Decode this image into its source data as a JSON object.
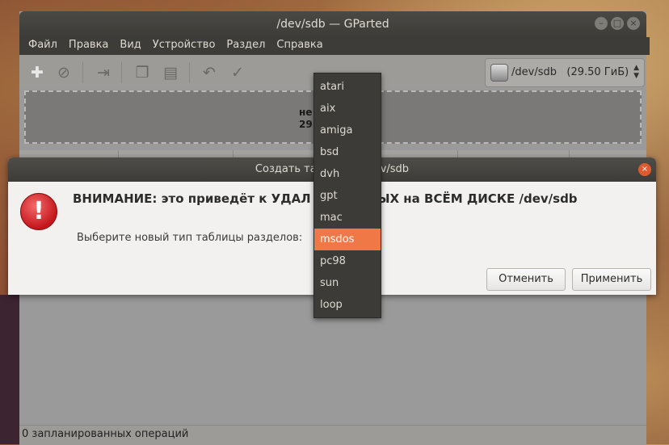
{
  "window": {
    "title": "/dev/sdb — GParted",
    "menu": [
      "Файл",
      "Правка",
      "Вид",
      "Устройство",
      "Раздел",
      "Справка"
    ],
    "device": "/dev/sdb",
    "device_size": "(29.50 ГиБ)",
    "disk_label1": "не р",
    "disk_label2": "29.5",
    "status": "0 запланированных операций"
  },
  "dialog": {
    "title": "Создать таблиц          на /dev/sdb",
    "warning": "ВНИМАНИЕ: это приведёт к УДАЛ           ЕХ ДАННЫХ на ВСЁМ ДИСКЕ /dev/sdb",
    "label": "Выберите новый тип таблицы разделов:",
    "cancel_label": "Отменить",
    "apply_label": "Применить",
    "options": [
      "atari",
      "aix",
      "amiga",
      "bsd",
      "dvh",
      "gpt",
      "mac",
      "msdos",
      "pc98",
      "sun",
      "loop"
    ],
    "selected": "msdos"
  },
  "colors": {
    "accent": "#f07746",
    "titlebar": "#3d3c38",
    "dialog_bg": "#f2f1f0",
    "warning_red": "#c4161c"
  },
  "icons": {
    "new_table": "new-partition-icon",
    "delete": "delete-icon",
    "resize": "resize-move-icon",
    "copy": "copy-icon",
    "paste": "paste-icon",
    "undo": "undo-icon",
    "apply": "apply-check-icon",
    "warning": "error-icon"
  }
}
